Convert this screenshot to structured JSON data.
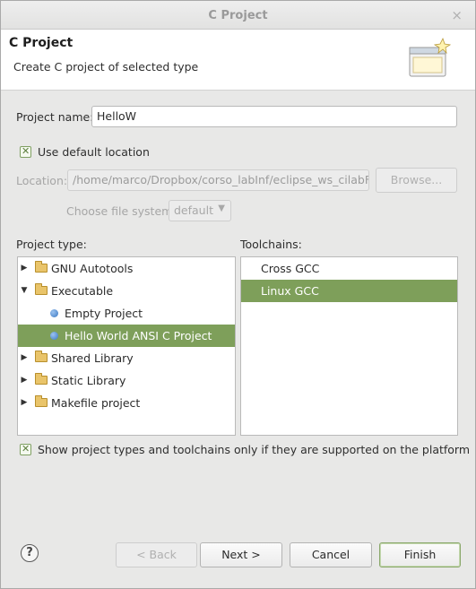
{
  "window": {
    "title": "C Project",
    "close_glyph": "×"
  },
  "banner": {
    "heading": "C Project",
    "subtitle": "Create C project of selected type",
    "icon": "wizard-banner-icon"
  },
  "project_name": {
    "label": "Project name:",
    "value": "HelloW"
  },
  "default_location": {
    "label": "Use default location",
    "checked": true
  },
  "location": {
    "label": "Location:",
    "value": "/home/marco/Dropbox/corso_labInf/eclipse_ws_cilabFisso/H",
    "browse_label": "Browse..."
  },
  "file_system": {
    "label": "Choose file system:",
    "value": "default"
  },
  "project_type": {
    "label": "Project type:",
    "items": [
      {
        "label": "GNU Autotools",
        "kind": "folder",
        "expander": "▶",
        "selected": false
      },
      {
        "label": "Executable",
        "kind": "folder",
        "expander": "▼",
        "selected": false
      },
      {
        "label": "Empty Project",
        "kind": "bullet",
        "expander": "",
        "selected": false
      },
      {
        "label": "Hello World ANSI C Project",
        "kind": "bullet",
        "expander": "",
        "selected": true
      },
      {
        "label": "Shared Library",
        "kind": "folder",
        "expander": "▶",
        "selected": false
      },
      {
        "label": "Static Library",
        "kind": "folder",
        "expander": "▶",
        "selected": false
      },
      {
        "label": "Makefile project",
        "kind": "folder",
        "expander": "▶",
        "selected": false
      }
    ]
  },
  "toolchains": {
    "label": "Toolchains:",
    "items": [
      {
        "label": "Cross GCC",
        "selected": false
      },
      {
        "label": "Linux GCC",
        "selected": true
      }
    ]
  },
  "filter_option": {
    "label": "Show project types and toolchains only if they are supported on the platform",
    "checked": true
  },
  "buttons": {
    "help": "?",
    "back": "< Back",
    "next": "Next >",
    "cancel": "Cancel",
    "finish": "Finish"
  },
  "colors": {
    "selection": "#7e9f5a",
    "check_accent": "#5d7f3e"
  }
}
